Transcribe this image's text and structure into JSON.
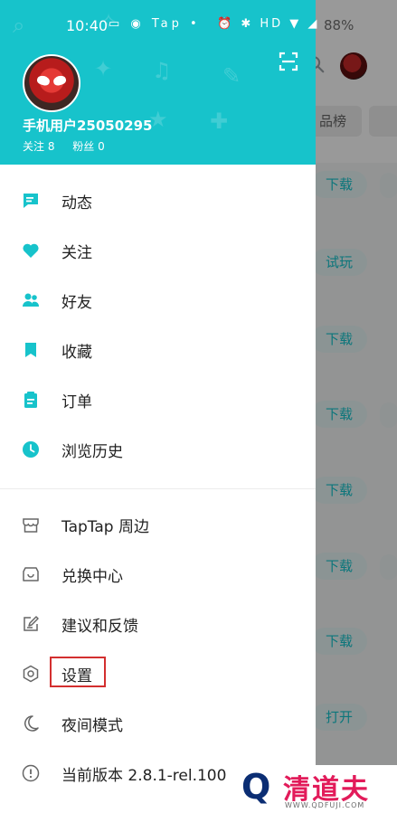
{
  "status_bar": {
    "time": "10:40",
    "left_icons": "▭ ◉ Tap •",
    "right_icons": "⏰ ✱ HD ▼ ◢",
    "battery": "88%"
  },
  "background": {
    "tab_label": "品榜",
    "buttons": [
      "下载",
      "试玩",
      "下载",
      "下载",
      "下载",
      "下载",
      "下载",
      "打开"
    ]
  },
  "drawer": {
    "username": "手机用户25050295",
    "following_label": "关注 8",
    "fans_label": "粉丝 0",
    "menu_primary": [
      {
        "label": "动态",
        "icon": "chat-bubble-icon"
      },
      {
        "label": "关注",
        "icon": "heart-icon"
      },
      {
        "label": "好友",
        "icon": "friends-icon"
      },
      {
        "label": "收藏",
        "icon": "bookmark-icon"
      },
      {
        "label": "订单",
        "icon": "clipboard-icon"
      },
      {
        "label": "浏览历史",
        "icon": "clock-icon"
      }
    ],
    "menu_secondary": [
      {
        "label": "TapTap 周边",
        "icon": "store-icon"
      },
      {
        "label": "兑换中心",
        "icon": "shopping-bag-icon"
      },
      {
        "label": "建议和反馈",
        "icon": "edit-icon"
      },
      {
        "label": "设置",
        "icon": "settings-hexagon-icon"
      },
      {
        "label": "夜间模式",
        "icon": "moon-icon"
      },
      {
        "label": "当前版本 2.8.1-rel.100",
        "icon": "info-icon"
      }
    ]
  },
  "watermark": {
    "brand": "清道夫",
    "url": "WWW.QDFUJI.COM"
  },
  "colors": {
    "accent": "#17c3cb",
    "highlight": "#d32f2f"
  }
}
